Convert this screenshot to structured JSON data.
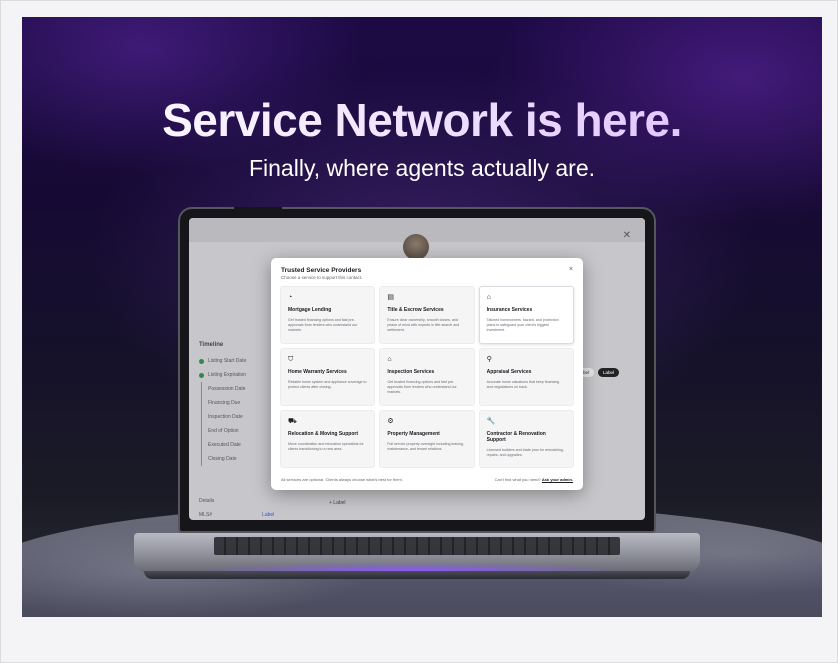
{
  "hero": {
    "headline": "Service Network is here.",
    "subhead": "Finally, where agents actually are."
  },
  "background_app": {
    "timeline_title": "Timeline",
    "timeline_items": [
      {
        "label": "Listing Start Date",
        "done": true
      },
      {
        "label": "Listing Expiration",
        "done": true
      },
      {
        "label": "Possession Date",
        "done": false
      },
      {
        "label": "Financing Due",
        "done": false
      },
      {
        "label": "Inspection Date",
        "done": false
      },
      {
        "label": "End of Option",
        "done": false
      },
      {
        "label": "Executed Date",
        "done": false
      },
      {
        "label": "Closing Date",
        "done": false
      }
    ],
    "details_title": "Details",
    "mls_label": "MLS#",
    "mls_value": "Label",
    "label_pill_1": "Label",
    "label_pill_2": "Label",
    "add_label": "+ Label"
  },
  "modal": {
    "title": "Trusted Service Providers",
    "subtitle": "Choose a service to support this contact.",
    "close": "×",
    "cards": [
      {
        "icon": "mortgage-icon",
        "glyph": "◔",
        "title": "Mortgage Lending",
        "desc": "Get trusted financing options and fast pre-approvals from lenders who understand our markets."
      },
      {
        "icon": "title-icon",
        "glyph": "▤",
        "title": "Title & Escrow Services",
        "desc": "Ensure clear ownership, smooth closes, and peace of mind with experts in title search and settlement."
      },
      {
        "icon": "insurance-icon",
        "glyph": "⌂",
        "title": "Insurance Services",
        "desc": "Tailored homeowners, hazard, and protection plans to safeguard your client's biggest investment."
      },
      {
        "icon": "shield-icon",
        "glyph": "⛉",
        "title": "Home Warranty Services",
        "desc": "Reliable home system and appliance coverage to protect clients after closing."
      },
      {
        "icon": "inspection-icon",
        "glyph": "⌂",
        "title": "Inspection Services",
        "desc": "Get trusted financing options and fast pre-approvals from lenders who understand our markets."
      },
      {
        "icon": "appraisal-icon",
        "glyph": "⚲",
        "title": "Appraisal Services",
        "desc": "Accurate home valuations that keep financing and negotiations on track."
      },
      {
        "icon": "truck-icon",
        "glyph": "⛟",
        "title": "Relocation & Moving Support",
        "desc": "Move coordination and relocation specialists for clients transitioning to a new area."
      },
      {
        "icon": "property-icon",
        "glyph": "⚙",
        "title": "Property Management",
        "desc": "Full service property oversight including leasing, maintenance, and tenant relations."
      },
      {
        "icon": "wrench-icon",
        "glyph": "🔧",
        "title": "Contractor & Renovation Support",
        "desc": "Licensed builders and trade pros for remodeling, repairs, and upgrades."
      }
    ],
    "footer_left": "All services are optional. Clients always choose what's best for them.",
    "footer_right": "Can't find what you need?",
    "footer_link": "Ask your admin."
  }
}
